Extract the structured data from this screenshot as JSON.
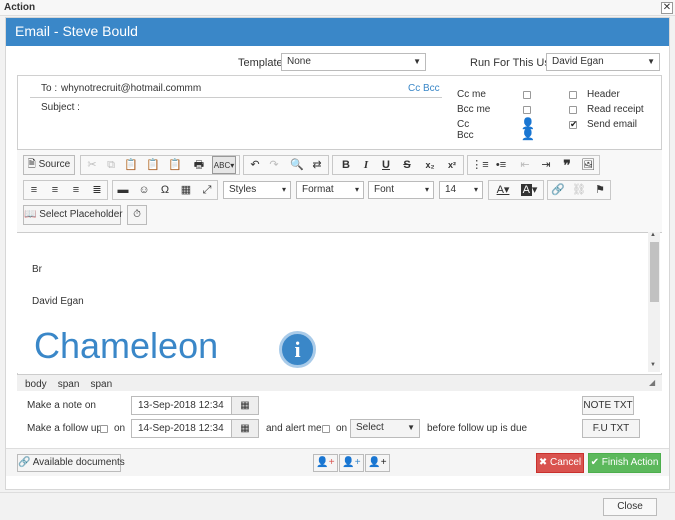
{
  "window": {
    "title": "Action",
    "close_glyph": "✕"
  },
  "dialog": {
    "title": "Email - Steve Bould"
  },
  "template": {
    "label": "Template",
    "value": "None"
  },
  "run_for_user": {
    "label": "Run For This User",
    "value": "David Egan"
  },
  "recipients": {
    "to_label": "To :",
    "to_value": "whynotrecruit@hotmail.commm",
    "cc_bcc_link": "Cc Bcc",
    "subject_label": "Subject :",
    "subject_value": ""
  },
  "options": {
    "cc_me": "Cc me",
    "bcc_me": "Bcc me",
    "cc": "Cc",
    "bcc": "Bcc",
    "header": "Header",
    "read_receipt": "Read receipt",
    "send_email": "Send email"
  },
  "toolbar": {
    "source": "Source",
    "styles": "Styles",
    "format": "Format",
    "font": "Font",
    "size": "14",
    "select_placeholder": "Select Placeholder"
  },
  "editor": {
    "line1": "Br",
    "line2": "David Egan",
    "logo_text": "Chameleon",
    "logo_badge": "i"
  },
  "status_path": [
    "body",
    "span",
    "span"
  ],
  "note": {
    "label": "Make a note on",
    "date": "13-Sep-2018 12:34",
    "note_txt": "NOTE TXT"
  },
  "followup": {
    "label": "Make a follow up",
    "on": "on",
    "date": "14-Sep-2018 12:34",
    "alert_label": "and alert me",
    "alert_on": "on",
    "select_value": "Select",
    "due_label": "before follow up is due",
    "fu_txt": "F.U TXT"
  },
  "footer": {
    "available_documents": "Available documents",
    "cancel": "Cancel",
    "finish": "Finish Action"
  },
  "bottom": {
    "close": "Close"
  },
  "colors": {
    "header_blue": "#3a87c8",
    "cancel_red": "#d9534f",
    "finish_green": "#5cb85c"
  }
}
